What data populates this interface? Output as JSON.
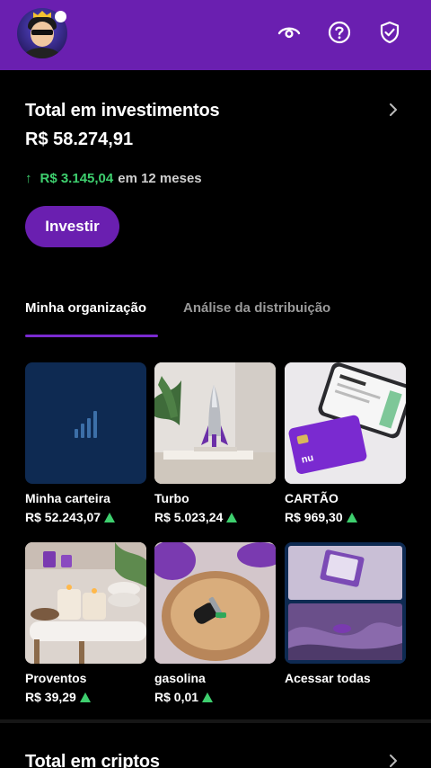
{
  "header": {
    "avatar_icon": "user-avatar-icon",
    "icons": [
      "eye-icon",
      "help-icon",
      "shield-check-icon"
    ],
    "background_color": "#6a1fb0"
  },
  "investments": {
    "title": "Total em investimentos",
    "total": "R$ 58.274,91",
    "growth_amount": "R$ 3.145,04",
    "growth_period": "em 12 meses",
    "growth_color": "#3ecf6e",
    "invest_button": "Investir"
  },
  "tabs": [
    {
      "label": "Minha organização",
      "active": true
    },
    {
      "label": "Análise da distribuição",
      "active": false
    }
  ],
  "cards": [
    {
      "name": "Minha carteira",
      "value": "R$ 52.243,07",
      "image": "signal-bars-icon"
    },
    {
      "name": "Turbo",
      "value": "R$ 5.023,24",
      "image": "rocket-image"
    },
    {
      "name": "CARTÃO",
      "value": "R$ 969,30",
      "image": "card-and-phone-image"
    },
    {
      "name": "Proventos",
      "value": "R$ 39,29",
      "image": "candles-image"
    },
    {
      "name": "gasolina",
      "value": "R$ 0,01",
      "image": "car-key-bowl-image"
    },
    {
      "name": "Acessar todas",
      "value": "",
      "image": "collage-image"
    }
  ],
  "crypto": {
    "title": "Total em criptos"
  }
}
